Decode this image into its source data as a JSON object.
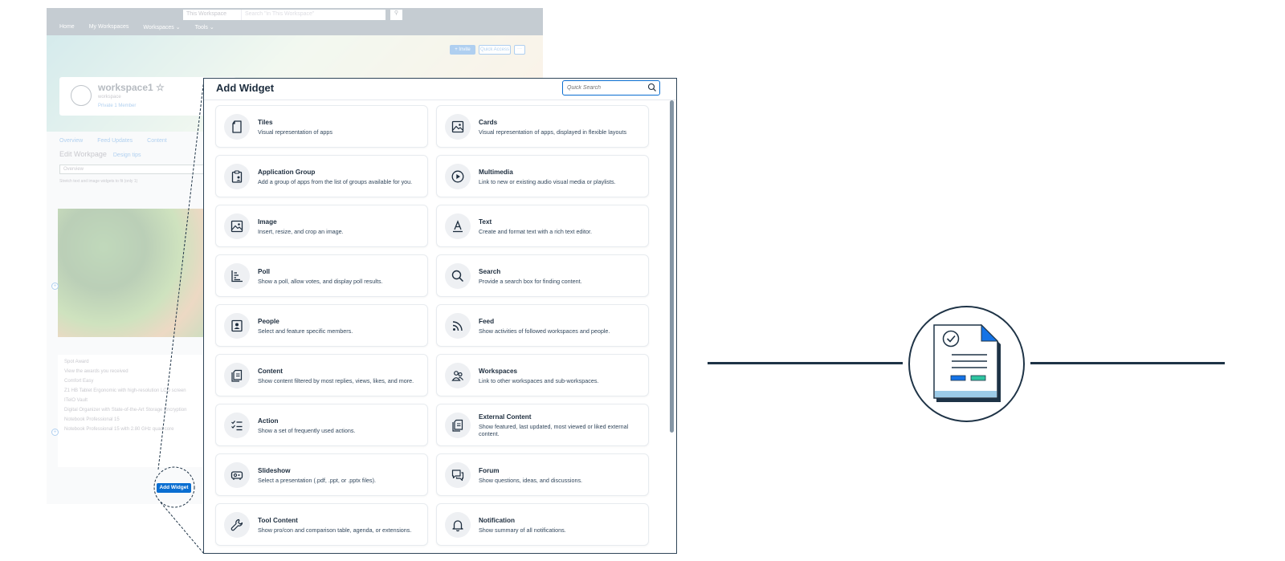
{
  "background_page": {
    "scope_select": "This Workspace",
    "search_placeholder": "Search \"in This Workspace\"",
    "nav": [
      "Home",
      "My Workspaces",
      "Workspaces ⌄",
      "Tools ⌄"
    ],
    "invite_label": "+ Invite",
    "quick_access_label": "Quick Access",
    "more_label": "···",
    "workspace_title": "workspace1 ☆",
    "workspace_subtitle": "workspace",
    "workspace_meta": "Private   1 Member",
    "tabs": [
      "Overview",
      "Feed Updates",
      "Content"
    ],
    "edit_title": "Edit Workpage",
    "design_tips": "Design tips",
    "section_select": "Overview",
    "checkbox_label": "Stretch text and image widgets to fit (only 1)",
    "awards": [
      "Spot Award",
      "View the awards you received",
      "Comfort Easy",
      "Z1 HB Tablet Ergonomic with high-resolution LCD screen",
      "ITelO Vault",
      "Digital Organizer with State-of-the-Art Storage Encryption",
      "Notebook Professional 15",
      "Notebook Professional 15 with 2.80 GHz quad core"
    ],
    "add_widget_label": "Add Widget"
  },
  "dialog": {
    "title": "Add Widget",
    "search_placeholder": "Quick Search",
    "widgets": [
      {
        "name": "Tiles",
        "desc": "Visual representation of apps",
        "icon": "tile-icon"
      },
      {
        "name": "Cards",
        "desc": "Visual representation of apps, displayed in flexible layouts",
        "icon": "card-image-icon"
      },
      {
        "name": "Application Group",
        "desc": "Add a group of apps from the list of groups available for you.",
        "icon": "clipboard-user-icon"
      },
      {
        "name": "Multimedia",
        "desc": "Link to new or existing audio visual media or playlists.",
        "icon": "play-icon"
      },
      {
        "name": "Image",
        "desc": "Insert, resize, and crop an image.",
        "icon": "image-icon"
      },
      {
        "name": "Text",
        "desc": "Create and format text with a rich text editor.",
        "icon": "text-format-icon"
      },
      {
        "name": "Poll",
        "desc": "Show a poll, allow votes, and display poll results.",
        "icon": "bar-chart-icon"
      },
      {
        "name": "Search",
        "desc": "Provide a search box for finding content.",
        "icon": "search-icon"
      },
      {
        "name": "People",
        "desc": "Select and feature specific members.",
        "icon": "contact-card-icon"
      },
      {
        "name": "Feed",
        "desc": "Show activities of followed workspaces and people.",
        "icon": "feed-icon"
      },
      {
        "name": "Content",
        "desc": "Show content filtered by most replies, views, likes, and more.",
        "icon": "documents-icon"
      },
      {
        "name": "Workspaces",
        "desc": "Link to other workspaces and sub-workspaces.",
        "icon": "group-icon"
      },
      {
        "name": "Action",
        "desc": "Show a set of frequently used actions.",
        "icon": "checklist-icon"
      },
      {
        "name": "External Content",
        "desc": "Show featured, last updated, most viewed or liked external content.",
        "icon": "external-documents-icon"
      },
      {
        "name": "Slideshow",
        "desc": "Select a presentation (.pdf, .ppt, or .pptx files).",
        "icon": "projector-icon"
      },
      {
        "name": "Forum",
        "desc": "Show questions, ideas, and discussions.",
        "icon": "discussion-icon"
      },
      {
        "name": "Tool Content",
        "desc": "Show pro/con and comparison table, agenda, or extensions.",
        "icon": "wrench-icon"
      },
      {
        "name": "Notification",
        "desc": "Show summary of all notifications.",
        "icon": "bell-icon"
      }
    ]
  },
  "colors": {
    "accent": "#0a6ed1",
    "dark_line": "#1e3346",
    "text": "#1d2d3e",
    "tile_icon_bg": "#eef0f3"
  }
}
